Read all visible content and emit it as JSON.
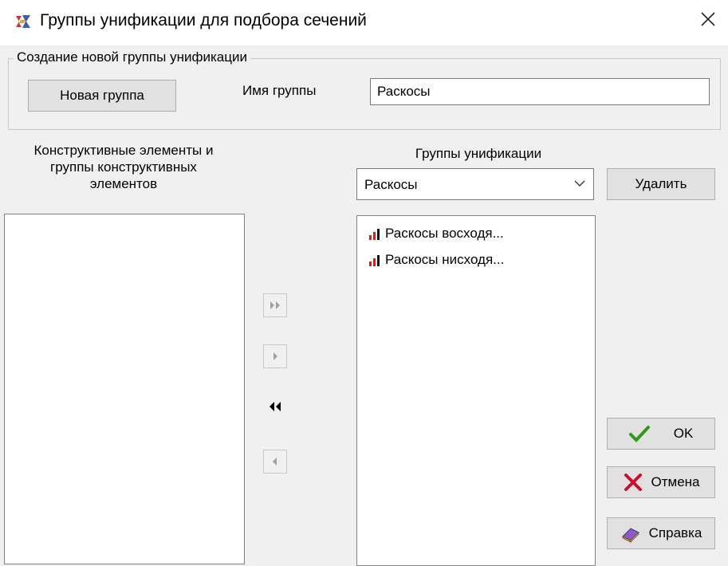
{
  "window": {
    "title": "Группы унификации для подбора сечений",
    "app_icon": "app-logo-icon",
    "close_icon": "close-icon"
  },
  "new_group": {
    "legend": "Создание новой группы унификации",
    "button_label": "Новая группа",
    "name_label": "Имя группы",
    "name_value": "Раскосы"
  },
  "elements_panel": {
    "caption_line1": "Конструктивные элементы и",
    "caption_line2": "группы конструктивных",
    "caption_line3": "элементов",
    "items": []
  },
  "groups_panel": {
    "caption": "Группы унификации",
    "selected_group": "Раскосы",
    "delete_label": "Удалить",
    "items": [
      {
        "label": "Раскосы восходя...",
        "icon": "bar-chart-icon"
      },
      {
        "label": "Раскосы нисходя...",
        "icon": "bar-chart-icon"
      }
    ]
  },
  "transfer_buttons": [
    {
      "name": "move-all-right-button",
      "icon": "double-right-arrow-icon",
      "enabled": false
    },
    {
      "name": "move-right-button",
      "icon": "right-arrow-icon",
      "enabled": false
    },
    {
      "name": "move-all-left-button",
      "icon": "double-left-arrow-icon",
      "enabled": true
    },
    {
      "name": "move-left-button",
      "icon": "left-arrow-icon",
      "enabled": false
    }
  ],
  "actions": {
    "ok_label": "OK",
    "cancel_label": "Отмена",
    "help_label": "Справка"
  },
  "colors": {
    "window_bg": "#f0f0f0",
    "button_bg": "#e1e1e1",
    "ok_check": "#2e9a1b",
    "cancel_x": "#c8102e",
    "bar_icon": "#d42020",
    "disabled_arrow": "#a0a0a0"
  }
}
